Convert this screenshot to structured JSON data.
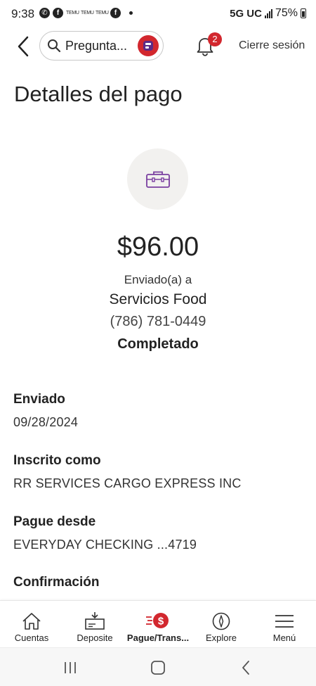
{
  "status_bar": {
    "time": "9:38",
    "notif_temu": [
      "TEMU",
      "TEMU",
      "TEMU"
    ],
    "network": "5G UC",
    "battery": "75%"
  },
  "header": {
    "search_placeholder": "Pregunta...",
    "notification_count": "2",
    "logout_label": "Cierre sesión"
  },
  "page": {
    "title": "Detalles del pago"
  },
  "payment": {
    "amount": "$96.00",
    "sent_to_label": "Enviado(a) a",
    "recipient": "Servicios Food",
    "phone": "(786) 781-0449",
    "status": "Completado"
  },
  "details": [
    {
      "label": "Enviado",
      "value": "09/28/2024"
    },
    {
      "label": "Inscrito como",
      "value": "RR SERVICES CARGO EXPRESS INC"
    },
    {
      "label": "Pague desde",
      "value": "EVERYDAY CHECKING ...4719"
    },
    {
      "label": "Confirmación",
      "value": ""
    }
  ],
  "bottom_nav": [
    {
      "label": "Cuentas",
      "icon": "home-icon"
    },
    {
      "label": "Deposite",
      "icon": "check-deposit-icon"
    },
    {
      "label": "Pague/Trans...",
      "icon": "pay-transfer-icon",
      "active": true
    },
    {
      "label": "Explore",
      "icon": "compass-icon"
    },
    {
      "label": "Menú",
      "icon": "hamburger-menu-icon"
    }
  ],
  "colors": {
    "accent_red": "#d2272e",
    "icon_purple": "#7a3fa0",
    "icon_circle_bg": "#f2f1ef"
  }
}
